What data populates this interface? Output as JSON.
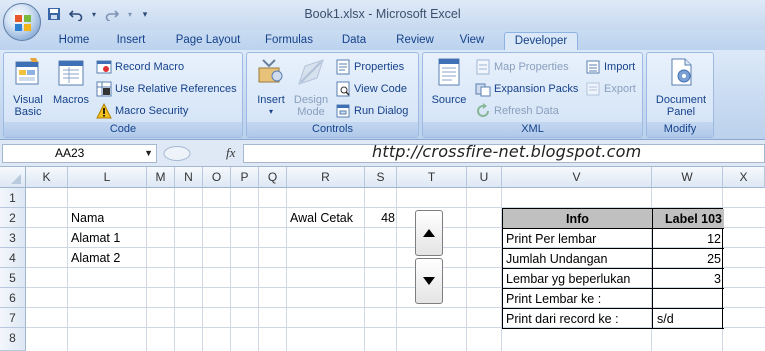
{
  "window": {
    "title": "Book1.xlsx - Microsoft Excel"
  },
  "tabs": [
    {
      "label": "Home"
    },
    {
      "label": "Insert"
    },
    {
      "label": "Page Layout"
    },
    {
      "label": "Formulas"
    },
    {
      "label": "Data"
    },
    {
      "label": "Review"
    },
    {
      "label": "View"
    },
    {
      "label": "Developer",
      "active": true
    }
  ],
  "ribbon": {
    "code": {
      "label": "Code",
      "visual_basic": "Visual\nBasic",
      "visual_basic_l1": "Visual",
      "visual_basic_l2": "Basic",
      "macros": "Macros",
      "record_macro": "Record Macro",
      "relative_refs": "Use Relative References",
      "macro_security": "Macro Security"
    },
    "controls": {
      "label": "Controls",
      "insert": "Insert",
      "design_mode_l1": "Design",
      "design_mode_l2": "Mode",
      "properties": "Properties",
      "view_code": "View Code",
      "run_dialog": "Run Dialog"
    },
    "xml": {
      "label": "XML",
      "source": "Source",
      "map_properties": "Map Properties",
      "expansion_packs": "Expansion Packs",
      "refresh_data": "Refresh Data",
      "import": "Import",
      "export": "Export"
    },
    "modify": {
      "label": "Modify",
      "document_panel_l1": "Document",
      "document_panel_l2": "Panel"
    }
  },
  "formula_bar": {
    "name_box": "AA23",
    "fx": "fx",
    "value": ""
  },
  "watermark": "http://crossfire-net.blogspot.com",
  "columns": [
    "K",
    "L",
    "M",
    "N",
    "O",
    "P",
    "Q",
    "R",
    "S",
    "T",
    "U",
    "V",
    "W",
    "X"
  ],
  "rows": [
    "1",
    "2",
    "3",
    "4",
    "5",
    "6",
    "7",
    "8"
  ],
  "cells": {
    "L2": "Nama",
    "L3": "Alamat 1",
    "L4": "Alamat 2",
    "R2": "Awal Cetak",
    "S2": "48"
  },
  "info_table": {
    "header": {
      "label": "Info",
      "value": "Label 103"
    },
    "rows": [
      {
        "label": "Print Per lembar",
        "value": "12"
      },
      {
        "label": "Jumlah Undangan",
        "value": "25"
      },
      {
        "label": "Lembar yg beperlukan",
        "value": "3"
      },
      {
        "label": "Print Lembar ke :",
        "value": ""
      },
      {
        "label": "Print dari record ke :",
        "value": "s/d"
      }
    ]
  }
}
